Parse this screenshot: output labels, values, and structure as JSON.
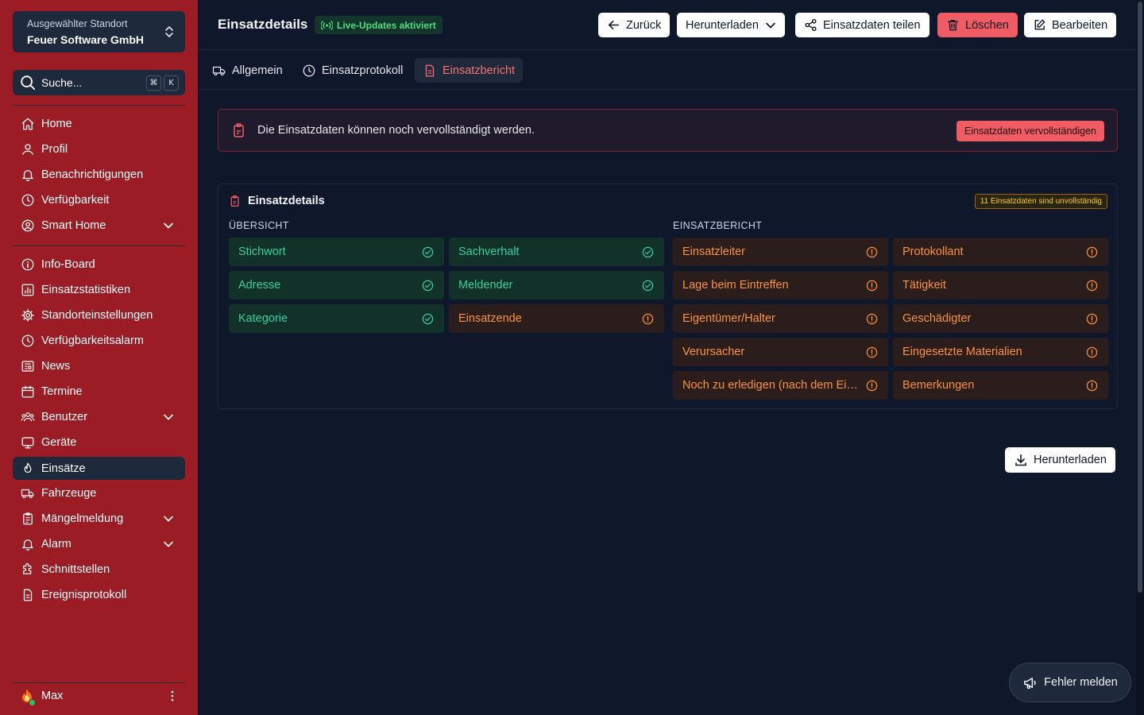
{
  "sidebar": {
    "location": {
      "label": "Ausgewählter Standort",
      "name": "Feuer Software GmbH"
    },
    "search": {
      "placeholder": "Suche...",
      "kbd1": "⌘",
      "kbd2": "K"
    },
    "group1": [
      {
        "label": "Home",
        "icon": "home-icon"
      },
      {
        "label": "Profil",
        "icon": "user-icon"
      },
      {
        "label": "Benachrichtigungen",
        "icon": "bell-icon"
      },
      {
        "label": "Verfügbarkeit",
        "icon": "clock-icon"
      },
      {
        "label": "Smart Home",
        "icon": "user-circle-icon",
        "expandable": true
      }
    ],
    "group2": [
      {
        "label": "Info-Board",
        "icon": "info-icon"
      },
      {
        "label": "Einsatzstatistiken",
        "icon": "chart-icon"
      },
      {
        "label": "Standorteinstellungen",
        "icon": "gear-icon"
      },
      {
        "label": "Verfügbarkeitsalarm",
        "icon": "clock-icon"
      },
      {
        "label": "News",
        "icon": "news-icon"
      },
      {
        "label": "Termine",
        "icon": "calendar-icon"
      },
      {
        "label": "Benutzer",
        "icon": "users-icon",
        "expandable": true
      },
      {
        "label": "Geräte",
        "icon": "monitor-icon"
      },
      {
        "label": "Einsätze",
        "icon": "fire-icon",
        "active": true
      },
      {
        "label": "Fahrzeuge",
        "icon": "truck-icon"
      },
      {
        "label": "Mängelmeldung",
        "icon": "clipboard-icon",
        "expandable": true
      },
      {
        "label": "Alarm",
        "icon": "bell-icon",
        "expandable": true
      },
      {
        "label": "Schnittstellen",
        "icon": "puzzle-icon"
      },
      {
        "label": "Ereignisprotokoll",
        "icon": "document-icon"
      }
    ],
    "user": {
      "name": "Max"
    }
  },
  "header": {
    "title": "Einsatzdetails",
    "live_badge": "Live-Updates aktiviert",
    "buttons": {
      "back": "Zurück",
      "download": "Herunterladen",
      "share": "Einsatzdaten teilen",
      "delete": "Löschen",
      "edit": "Bearbeiten"
    }
  },
  "tabs": [
    {
      "label": "Allgemein",
      "icon": "truck-icon"
    },
    {
      "label": "Einsatzprotokoll",
      "icon": "clock-icon"
    },
    {
      "label": "Einsatzbericht",
      "icon": "document-icon",
      "active": true
    }
  ],
  "notice": {
    "text": "Die Einsatzdaten können noch vervollständigt werden.",
    "button": "Einsatzdaten vervollständigen"
  },
  "panel": {
    "title": "Einsatzdetails",
    "badge": "11 Einsatzdaten sind unvollständig",
    "overview_label": "ÜBERSICHT",
    "report_label": "EINSATZBERICHT",
    "overview": [
      {
        "label": "Stichwort",
        "status": "complete"
      },
      {
        "label": "Sachverhalt",
        "status": "complete"
      },
      {
        "label": "Adresse",
        "status": "complete"
      },
      {
        "label": "Meldender",
        "status": "complete"
      },
      {
        "label": "Kategorie",
        "status": "complete"
      },
      {
        "label": "Einsatzende",
        "status": "incomplete"
      }
    ],
    "report": [
      {
        "label": "Einsatzleiter",
        "status": "incomplete"
      },
      {
        "label": "Protokollant",
        "status": "incomplete"
      },
      {
        "label": "Lage beim Eintreffen",
        "status": "incomplete"
      },
      {
        "label": "Tätigkeit",
        "status": "incomplete"
      },
      {
        "label": "Eigentümer/Halter",
        "status": "incomplete"
      },
      {
        "label": "Geschädigter",
        "status": "incomplete"
      },
      {
        "label": "Verursacher",
        "status": "incomplete"
      },
      {
        "label": "Eingesetzte Materialien",
        "status": "incomplete"
      },
      {
        "label": "Noch zu erledigen (nach dem Einsatz)",
        "status": "incomplete"
      },
      {
        "label": "Bemerkungen",
        "status": "incomplete"
      }
    ]
  },
  "download_button": "Herunterladen",
  "report_bug": "Fehler melden",
  "colors": {
    "sidebar": "#9b1c25",
    "background": "#0f172a",
    "accent_red": "#f05c64",
    "complete_green": "#34d399",
    "incomplete_orange": "#fb923c",
    "live_green": "#4ade80"
  }
}
